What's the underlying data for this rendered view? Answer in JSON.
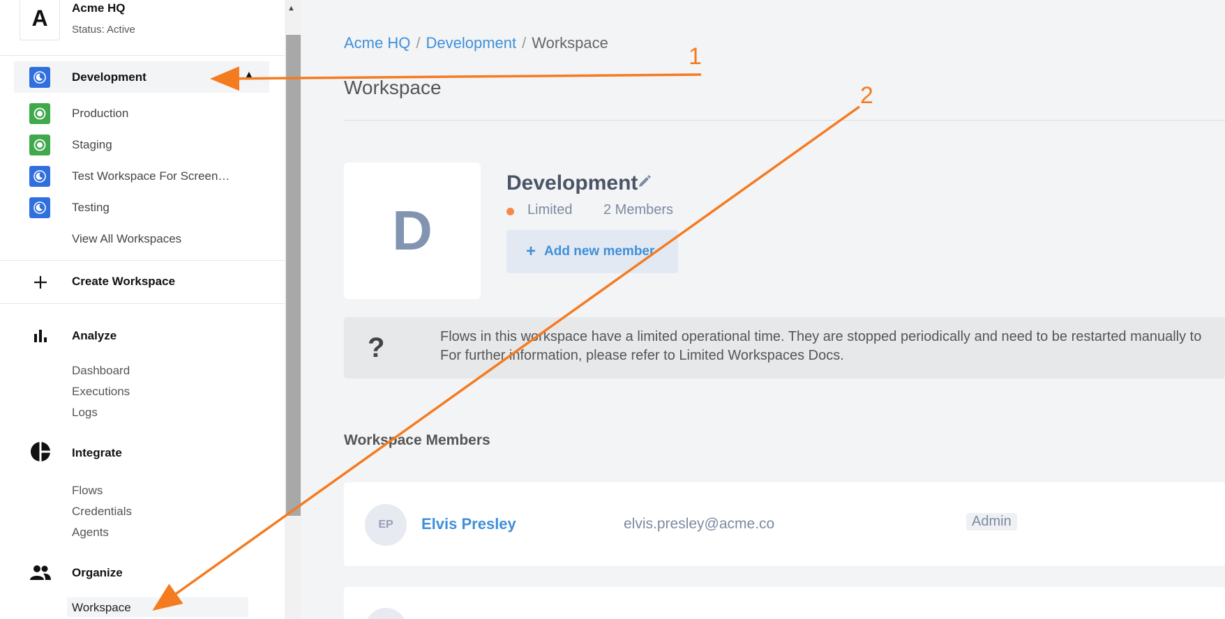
{
  "org": {
    "avatar_letter": "A",
    "name": "Acme HQ",
    "status": "Status: Active"
  },
  "workspaces": [
    {
      "label": "Development",
      "color": "#2f6fde",
      "active": true
    },
    {
      "label": "Production",
      "color": "#3fa94c"
    },
    {
      "label": "Staging",
      "color": "#3fa94c"
    },
    {
      "label": "Test Workspace For Screen…",
      "color": "#2f6fde"
    },
    {
      "label": "Testing",
      "color": "#2f6fde"
    }
  ],
  "view_all_label": "View All Workspaces",
  "create_workspace_label": "Create Workspace",
  "sections": {
    "analyze": {
      "label": "Analyze",
      "icon": "bar-chart-icon",
      "items": [
        "Dashboard",
        "Executions",
        "Logs"
      ]
    },
    "integrate": {
      "label": "Integrate",
      "icon": "pie-chart-icon",
      "items": [
        "Flows",
        "Credentials",
        "Agents"
      ]
    },
    "organize": {
      "label": "Organize",
      "icon": "people-icon",
      "items": [
        "Workspace"
      ]
    }
  },
  "breadcrumb": [
    "Acme HQ",
    "Development",
    "Workspace"
  ],
  "breadcrumb_sep": "/",
  "page_title": "Workspace",
  "workspace": {
    "avatar_letter": "D",
    "name": "Development",
    "status": "Limited",
    "status_color": "#f5894a",
    "members_count": "2 Members",
    "add_member_label": "Add new member"
  },
  "notice": {
    "icon": "question-icon",
    "line1": "Flows in this workspace have a limited operational time. They are stopped periodically and need to be restarted manually to",
    "line2": "For further information, please refer to Limited Workspaces Docs."
  },
  "members_heading": "Workspace Members",
  "members": [
    {
      "initials": "EP",
      "name": "Elvis Presley",
      "email": "elvis.presley@acme.co",
      "role": "Admin"
    }
  ],
  "annotations": [
    "1",
    "2"
  ],
  "accent": "#3f8fd8",
  "annotation_color": "#f47b20"
}
